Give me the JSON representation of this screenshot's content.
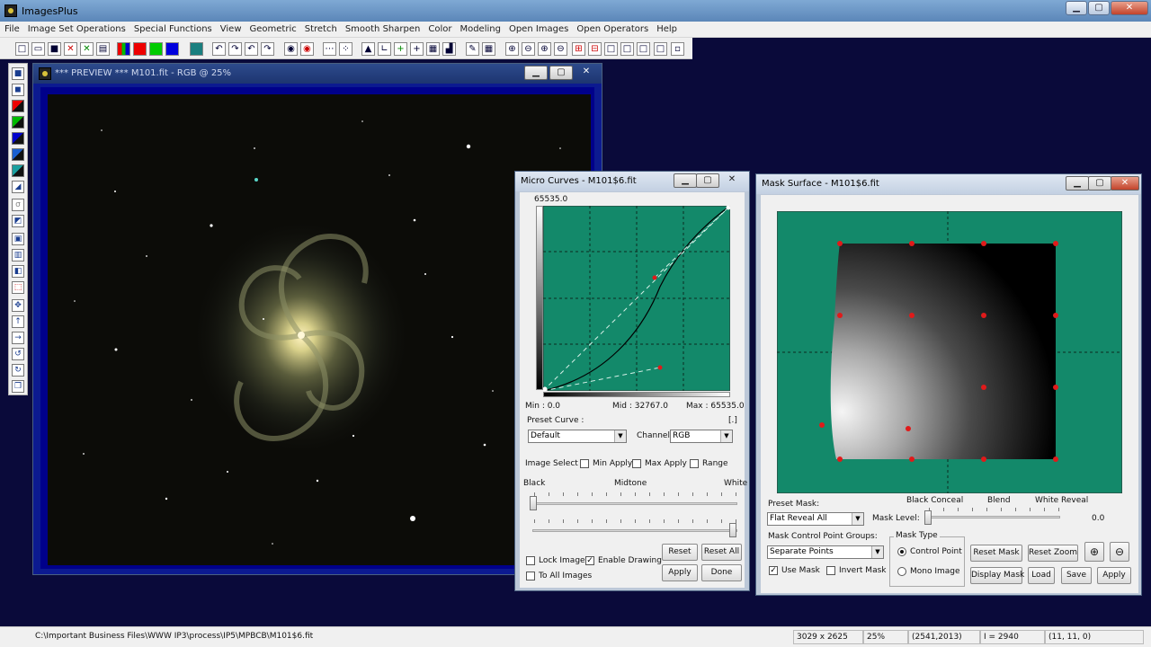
{
  "app": {
    "title": "ImagesPlus"
  },
  "menu": [
    "File",
    "Image Set Operations",
    "Special Functions",
    "View",
    "Geometric",
    "Stretch",
    "Smooth Sharpen",
    "Color",
    "Modeling",
    "Open Images",
    "Open Operators",
    "Help"
  ],
  "preview_window": {
    "title": "*** PREVIEW *** M101.fit - RGB @ 25%"
  },
  "micro_curves": {
    "title": "Micro Curves - M101$6.fit",
    "max_top": "65535.0",
    "min_label": "Min : 0.0",
    "mid_label": "Mid : 32767.0",
    "max_label": "Max : 65535.0",
    "preset_curve_label": "Preset Curve :",
    "bracket": "[.]",
    "preset_curve_value": "Default",
    "channel_label": "Channel:",
    "channel_value": "RGB",
    "image_select_label": "Image Select",
    "min_apply": "Min Apply",
    "max_apply": "Max Apply",
    "range": "Range",
    "black": "Black",
    "midtone": "Midtone",
    "white": "White",
    "lock_image": "Lock Image",
    "enable_drawing": "Enable Drawing",
    "to_all_images": "To All Images",
    "reset": "Reset",
    "reset_all": "Reset All",
    "apply": "Apply",
    "done": "Done"
  },
  "mask_surface": {
    "title": "Mask Surface - M101$6.fit",
    "preset_mask_label": "Preset Mask:",
    "preset_mask_value": "Flat Reveal All",
    "black_conceal": "Black Conceal",
    "blend": "Blend",
    "white_reveal": "White Reveal",
    "mask_level_label": "Mask Level:",
    "mask_level_value": "0.0",
    "groups_label": "Mask Control Point Groups:",
    "groups_value": "Separate Points",
    "mask_type_label": "Mask Type",
    "control_point": "Control Point",
    "mono_image": "Mono Image",
    "use_mask": "Use Mask",
    "invert_mask": "Invert Mask",
    "reset_mask": "Reset Mask",
    "reset_zoom": "Reset Zoom",
    "display_mask": "Display Mask",
    "load": "Load",
    "save": "Save",
    "apply": "Apply"
  },
  "status": {
    "path": "C:\\Important Business Files\\WWW IP3\\process\\IP5\\MPBCB\\M101$6.fit",
    "dims": "3029 x 2625",
    "zoom": "25%",
    "coords": "(2541,2013)",
    "intensity": "I = 2940",
    "rgb": "(11, 11, 0)"
  },
  "colors": {
    "mask_green": "#13896a",
    "curve_green": "#13896a",
    "control_point": "#e01a1a",
    "mdi_bg": "#0a0a3a"
  }
}
